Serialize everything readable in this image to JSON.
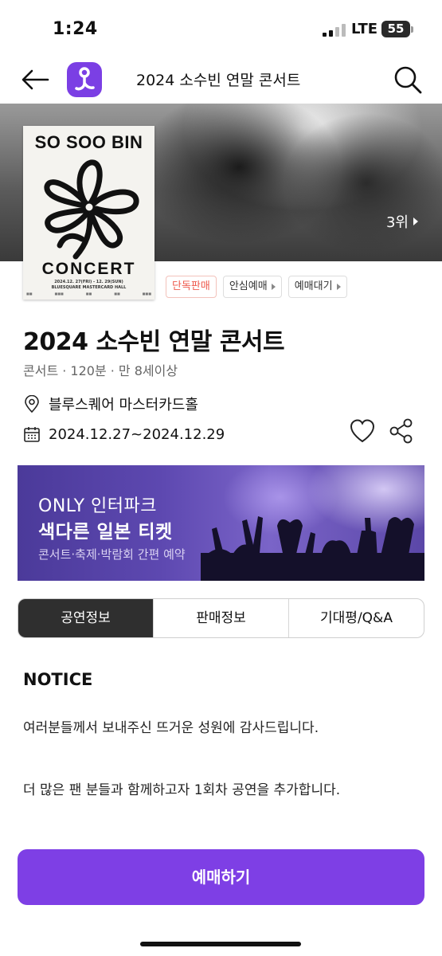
{
  "status_bar": {
    "time": "1:24",
    "network": "LTE",
    "battery": "55"
  },
  "nav": {
    "title": "2024 소수빈 연말 콘서트",
    "logo_color": "#7b3fe4"
  },
  "hero": {
    "rank": "3위"
  },
  "poster": {
    "top_text": "SO SOO BIN",
    "bottom_text": "CONCERT",
    "date_line": "2024.12. 27(FRI) - 12. 29(SUN)",
    "venue_line": "BLUESQUARE MASTERCARD HALL"
  },
  "badges": [
    {
      "label": "단독판매",
      "kind": "exclusive"
    },
    {
      "label": "안심예매",
      "kind": "link"
    },
    {
      "label": "예매대기",
      "kind": "link"
    }
  ],
  "event": {
    "title": "2024 소수빈 연말 콘서트",
    "meta": "콘서트 · 120분 · 만 8세이상",
    "venue": "블루스퀘어 마스터카드홀",
    "date": "2024.12.27~2024.12.29"
  },
  "banner": {
    "line1": "ONLY 인터파크",
    "line2": "색다른 일본 티켓",
    "line3": "콘서트·축제·박람회 간편 예약"
  },
  "tabs": [
    {
      "label": "공연정보",
      "active": true
    },
    {
      "label": "판매정보",
      "active": false
    },
    {
      "label": "기대평/Q&A",
      "active": false
    }
  ],
  "notice": {
    "heading": "NOTICE",
    "lines": [
      "여러분들께서 보내주신 뜨거운 성원에 감사드립니다.",
      "더 많은 팬 분들과 함께하고자 1회차 공연을 추가합니다."
    ]
  },
  "book_button": {
    "label": "예매하기",
    "color": "#7e3fe5"
  }
}
